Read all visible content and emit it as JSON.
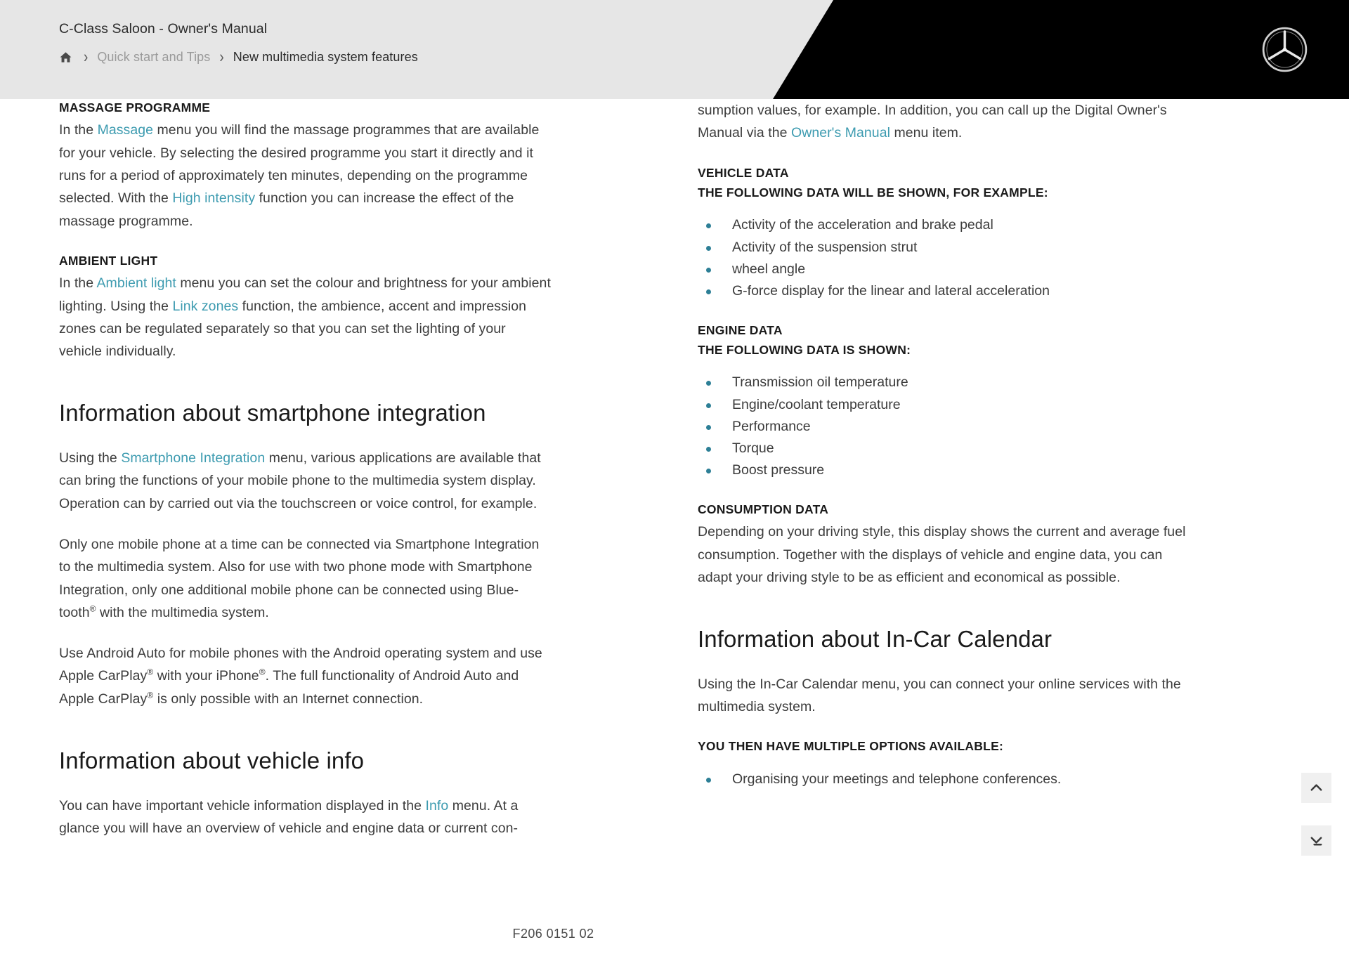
{
  "header": {
    "doc_title": "C-Class Saloon - Owner's Manual",
    "home_icon": "home-icon",
    "separator": "›",
    "breadcrumb": [
      {
        "label": "Quick start and Tips",
        "current": false
      },
      {
        "label": "New multimedia system features",
        "current": true
      }
    ],
    "logo": "mercedes-benz-star-logo"
  },
  "colors": {
    "link": "#3d9bb0",
    "bullet": "#2d7f96",
    "header_bg": "#e6e6e6",
    "banner_bg": "#000000",
    "body_text": "#3c3c3c"
  },
  "left_column": {
    "massage": {
      "subhead": "MASSAGE PROGRAMME",
      "text_1": "In the ",
      "link_1": "Massage",
      "text_2": " menu you will find the massage programmes that are available for your vehicle. By selecting the desired programme you start it directly and it runs for a period of approximately ten minutes, depending on the programme selected. With the ",
      "link_2": "High intensity",
      "text_3": " function you can increase the effect of the massage programme."
    },
    "ambient": {
      "subhead": "AMBIENT LIGHT",
      "text_1": "In the ",
      "link_1": "Ambient light",
      "text_2": " menu you can set the colour and brightness for your ambient lighting. Using the ",
      "link_2": "Link zones",
      "text_3": " function, the ambience, accent and impression zones can be regulated separately so that you can set the lighting of your vehicle individually."
    },
    "smartphone": {
      "heading": "Information about smartphone integration",
      "p1_text_1": "Using the ",
      "p1_link": "Smartphone Integration",
      "p1_text_2": " menu, various applications are available that can bring the functions of your mobile phone to the multimedia system display. Operation can by carried out via the touchscreen or voice control, for example.",
      "p2": "Only one mobile phone at a time can be connected via Smartphone Integration to the multimedia system. Also for use with two phone mode with Smartphone Integration, only one additional mobile phone can be connected using Blue-tooth",
      "p2_sup": "®",
      "p2_end": " with the multimedia system.",
      "p3_a": "Use Android Auto for mobile phones with the Android operating system and use Apple CarPlay",
      "p3_sup1": "®",
      "p3_b": " with your iPhone",
      "p3_sup2": "®",
      "p3_c": ". The full functionality of Android Auto and Apple CarPlay",
      "p3_sup3": "®",
      "p3_d": " is only possible with an Internet connection."
    },
    "vehicle_info": {
      "heading": "Information about vehicle info",
      "p1_text_1": "You can have important vehicle information displayed in the ",
      "p1_link": "Info",
      "p1_text_2": " menu. At a glance you will have an overview of vehicle and engine data or current con-"
    }
  },
  "right_column": {
    "continuation": {
      "text_1": "sumption values, for example. In addition, you can call up the Digital Owner's Manual via the ",
      "link_1": "Owner's Manual",
      "text_2": " menu item."
    },
    "vehicle_data": {
      "subhead": "VEHICLE DATA",
      "intro": "THE FOLLOWING DATA WILL BE SHOWN, FOR EXAMPLE:",
      "items": [
        "Activity of the acceleration and brake pedal",
        "Activity of the suspension strut",
        "wheel angle",
        "G-force display for the linear and lateral acceleration"
      ]
    },
    "engine_data": {
      "subhead": "ENGINE DATA",
      "intro": "THE FOLLOWING DATA IS SHOWN:",
      "items": [
        "Transmission oil temperature",
        "Engine/coolant temperature",
        "Performance",
        "Torque",
        "Boost pressure"
      ]
    },
    "consumption_data": {
      "subhead": "CONSUMPTION DATA",
      "text": "Depending on your driving style, this display shows the current and average fuel consumption. Together with the displays of vehicle and engine data, you can adapt your driving style to be as efficient and economical as possible."
    },
    "calendar": {
      "heading": "Information about In-Car Calendar",
      "intro_text": "Using the In-Car Calendar menu, you can connect your online services with the multimedia system.",
      "options_head": "YOU THEN HAVE MULTIPLE OPTIONS AVAILABLE:",
      "items": [
        "Organising your meetings and telephone conferences."
      ]
    }
  },
  "footer": {
    "code": "F206 0151 02"
  },
  "nav_buttons": {
    "scroll_top": "chevron-up-icon",
    "scroll_bottom": "chevron-down-to-line-icon"
  }
}
